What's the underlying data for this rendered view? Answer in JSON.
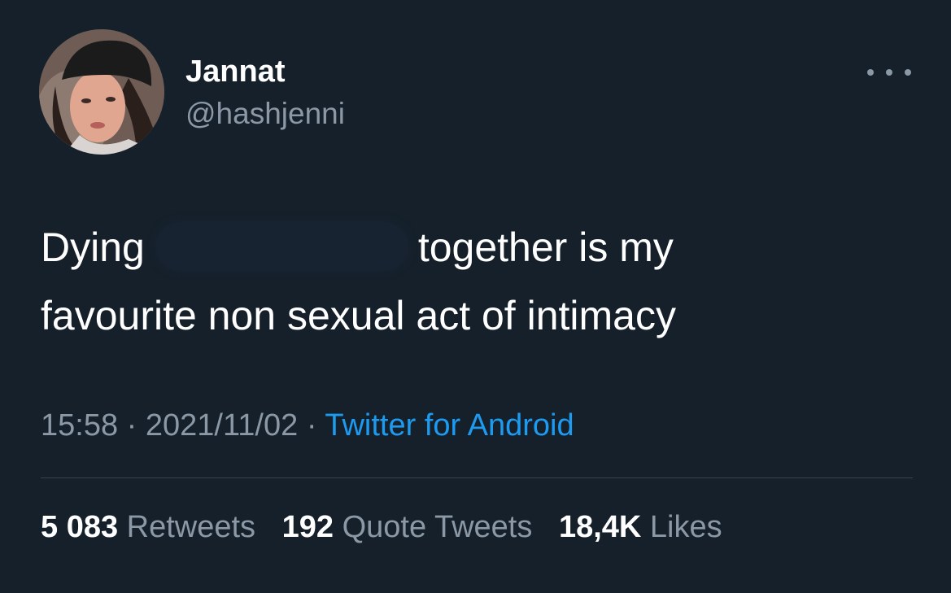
{
  "tweet": {
    "author": {
      "display_name": "Jannat",
      "handle": "@hashjenni"
    },
    "text_line1_start": "Dying",
    "text_line1_end": "together is my",
    "text_line2": "favourite non sexual act of intimacy",
    "timestamp_time": "15:58",
    "separator": "·",
    "timestamp_date": "2021/11/02",
    "source": "Twitter for Android",
    "stats": {
      "retweets_count": "5 083",
      "retweets_label": "Retweets",
      "quote_tweets_count": "192",
      "quote_tweets_label": "Quote Tweets",
      "likes_count": "18,4K",
      "likes_label": "Likes"
    }
  },
  "icons": {
    "more": "more-horizontal-icon"
  },
  "colors": {
    "background": "#15202b",
    "primary_text": "#ffffff",
    "secondary_text": "#8b98a5",
    "link": "#1d9bf0",
    "divider": "#38444d"
  }
}
